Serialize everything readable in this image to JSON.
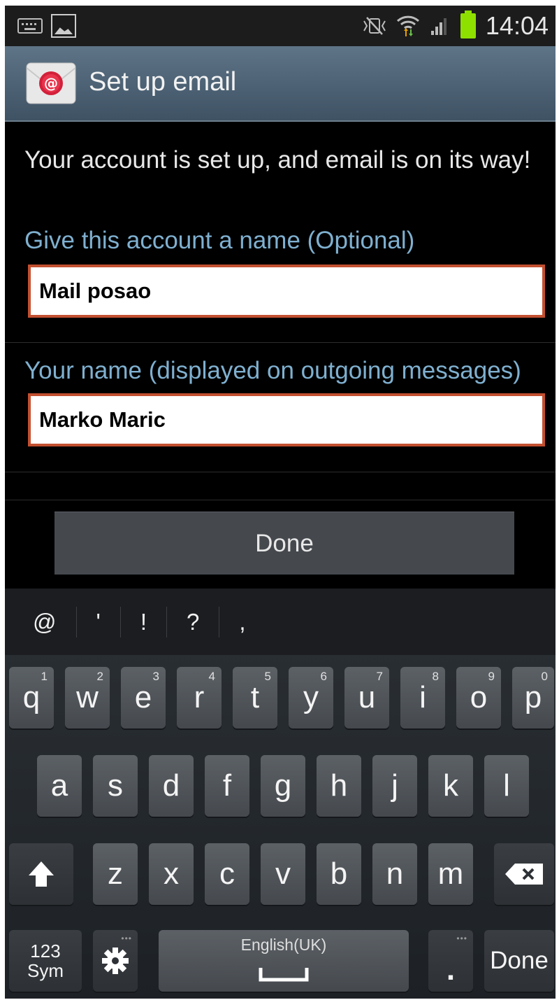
{
  "status_bar": {
    "time": "14:04"
  },
  "header": {
    "title": "Set up email"
  },
  "form": {
    "message": "Your account is set up, and email is on its way!",
    "account_name_label": "Give this account a name (Optional)",
    "account_name_value": "Mail posao",
    "your_name_label": "Your name (displayed on outgoing messages)",
    "your_name_value": "Marko Maric",
    "done_label": "Done"
  },
  "keyboard": {
    "suggestions": [
      "@",
      "'",
      "!",
      "?",
      ","
    ],
    "row1": [
      {
        "letter": "q",
        "number": "1"
      },
      {
        "letter": "w",
        "number": "2"
      },
      {
        "letter": "e",
        "number": "3"
      },
      {
        "letter": "r",
        "number": "4"
      },
      {
        "letter": "t",
        "number": "5"
      },
      {
        "letter": "y",
        "number": "6"
      },
      {
        "letter": "u",
        "number": "7"
      },
      {
        "letter": "i",
        "number": "8"
      },
      {
        "letter": "o",
        "number": "9"
      },
      {
        "letter": "p",
        "number": "0"
      }
    ],
    "row2": [
      "a",
      "s",
      "d",
      "f",
      "g",
      "h",
      "j",
      "k",
      "l"
    ],
    "row3": [
      "z",
      "x",
      "c",
      "v",
      "b",
      "n",
      "m"
    ],
    "sym_line1": "123",
    "sym_line2": "Sym",
    "space_label": "English(UK)",
    "period": ".",
    "done_label": "Done"
  },
  "colors": {
    "field_border": "#c25030",
    "label": "#7fb0d0",
    "battery": "#8ee000"
  }
}
